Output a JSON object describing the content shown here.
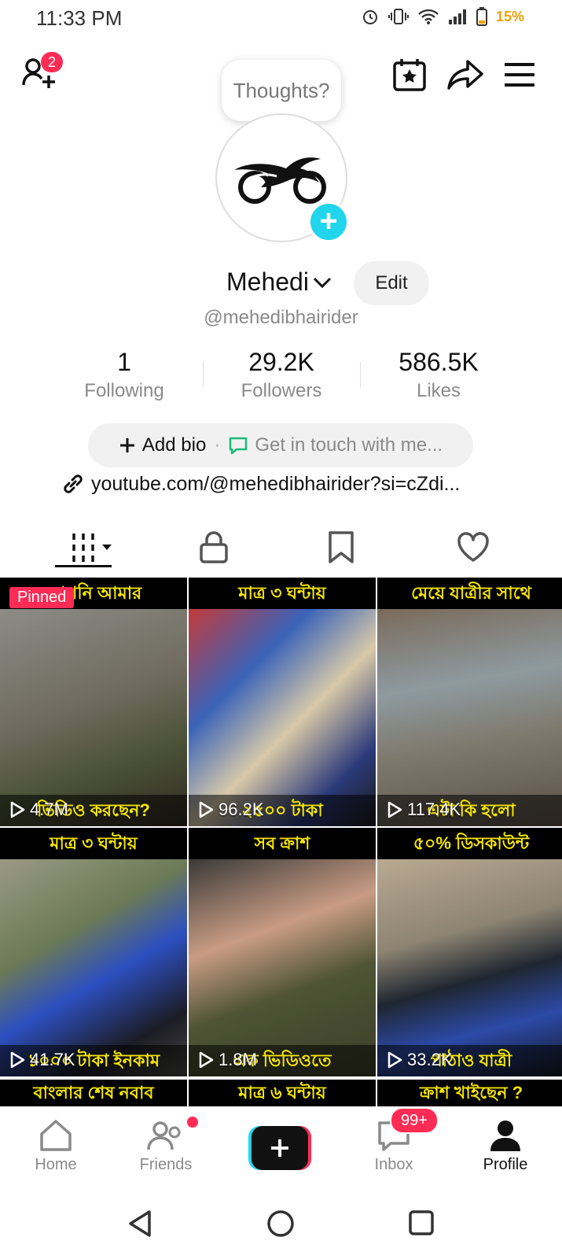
{
  "status_bar": {
    "time": "11:33 PM",
    "battery": "15%"
  },
  "header": {
    "friend_requests_badge": "2",
    "thoughts_placeholder": "Thoughts?",
    "icons": [
      "add-friends-icon",
      "calendar-star-icon",
      "share-icon",
      "menu-icon"
    ]
  },
  "profile": {
    "display_name": "Mehedi",
    "edit_label": "Edit",
    "username": "@mehedibhairider",
    "stats": [
      {
        "value": "1",
        "label": "Following"
      },
      {
        "value": "29.2K",
        "label": "Followers"
      },
      {
        "value": "586.5K",
        "label": "Likes"
      }
    ],
    "add_bio": "Add bio",
    "get_in_touch": "Get in touch with me...",
    "link": "youtube.com/@mehedibhairider?si=cZdi..."
  },
  "tabs": [
    "videos-grid-icon",
    "lock-icon",
    "bookmark-icon",
    "heart-icon"
  ],
  "videos": [
    {
      "top": "আপনি আমার",
      "bottom": "ভিডিও করছেন?",
      "views": "4.7M",
      "pinned": "Pinned"
    },
    {
      "top": "মাত্র ৩ ঘন্টায়",
      "bottom": "২৫০০ টাকা",
      "views": "96.2K"
    },
    {
      "top": "মেয়ে যাত্রীর সাথে",
      "bottom": "এটা কি হলো",
      "views": "117.4K"
    },
    {
      "top": "মাত্র ৩ ঘন্টায়",
      "bottom": "১০০০ টাকা ইনকাম",
      "views": "41.7K"
    },
    {
      "top": "সব ক্রাশ",
      "bottom": "এক ভিডিওতে",
      "views": "1.8M"
    },
    {
      "top": "৫০% ডিসকাউন্ট",
      "bottom": "পাঠাও যাত্রী",
      "views": "33.2K"
    }
  ],
  "next_row_captions": [
    "বাংলার শেষ নবাব",
    "মাত্র ৬ ঘন্টায়",
    "ক্রাশ খাইছেন ?"
  ],
  "bottom_nav": {
    "home": "Home",
    "friends": "Friends",
    "inbox": "Inbox",
    "inbox_badge": "99+",
    "profile": "Profile"
  },
  "colors": {
    "accent_red": "#fe2c55",
    "accent_cyan": "#20d5ec",
    "caption_yellow": "#f5e600"
  }
}
